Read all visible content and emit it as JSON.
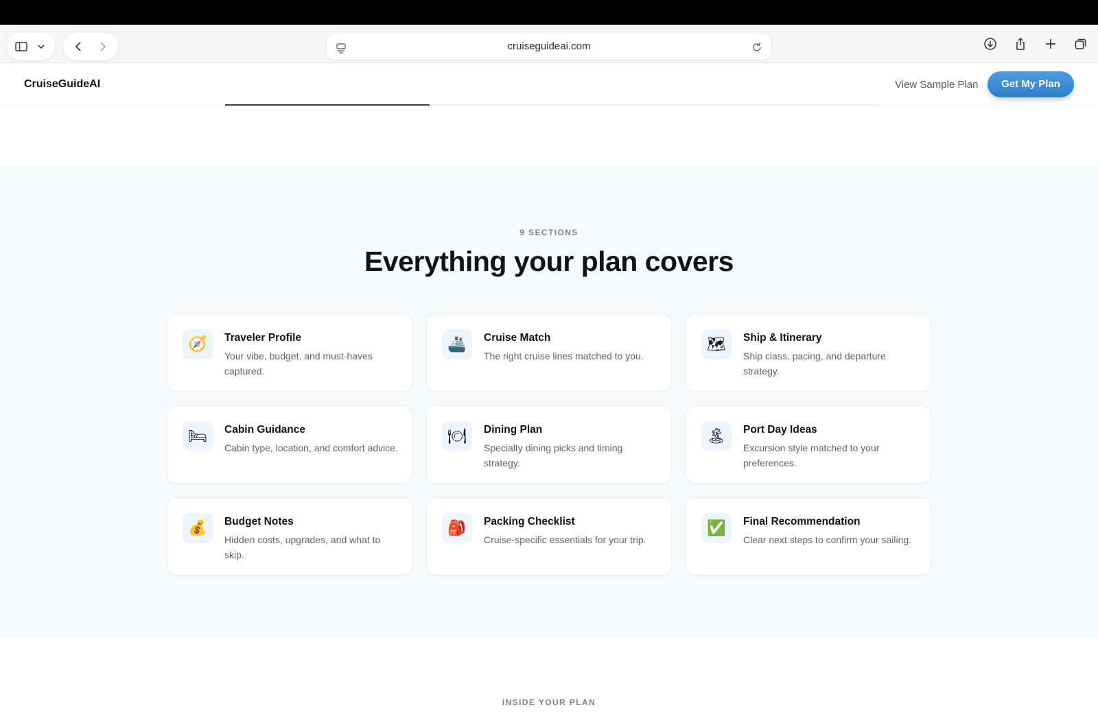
{
  "browser": {
    "url": "cruiseguideai.com",
    "icons": [
      "sidebar-icon",
      "chevron-down-icon",
      "back-icon",
      "forward-icon",
      "page-menu-icon",
      "reload-icon",
      "download-icon",
      "share-icon",
      "new-tab-icon",
      "tabs-overview-icon"
    ]
  },
  "nav": {
    "brand": "CruiseGuideAI",
    "link": "View Sample Plan",
    "cta": "Get My Plan",
    "cta_color": "#3a8ad6"
  },
  "section": {
    "kicker": "9 SECTIONS",
    "title": "Everything your plan covers",
    "cards": [
      {
        "icon": "🧭",
        "icon_name": "compass-icon",
        "title": "Traveler Profile",
        "desc": "Your vibe, budget, and must-haves captured."
      },
      {
        "icon": "🚢",
        "icon_name": "ship-icon",
        "title": "Cruise Match",
        "desc": "The right cruise lines matched to you."
      },
      {
        "icon": "🗺",
        "icon_name": "map-icon",
        "title": "Ship & Itinerary",
        "desc": "Ship class, pacing, and departure strategy."
      },
      {
        "icon": "🛏",
        "icon_name": "bed-icon",
        "title": "Cabin Guidance",
        "desc": "Cabin type, location, and comfort advice."
      },
      {
        "icon": "🍽",
        "icon_name": "dining-icon",
        "title": "Dining Plan",
        "desc": "Specialty dining picks and timing strategy."
      },
      {
        "icon": "🏝",
        "icon_name": "island-icon",
        "title": "Port Day Ideas",
        "desc": "Excursion style matched to your preferences."
      },
      {
        "icon": "💰",
        "icon_name": "money-bag-icon",
        "title": "Budget Notes",
        "desc": "Hidden costs, upgrades, and what to skip."
      },
      {
        "icon": "🎒",
        "icon_name": "backpack-icon",
        "title": "Packing Checklist",
        "desc": "Cruise-specific essentials for your trip."
      },
      {
        "icon": "✅",
        "icon_name": "check-icon",
        "title": "Final Recommendation",
        "desc": "Clear next steps to confirm your sailing."
      }
    ]
  },
  "next_section": {
    "kicker": "INSIDE YOUR PLAN"
  }
}
